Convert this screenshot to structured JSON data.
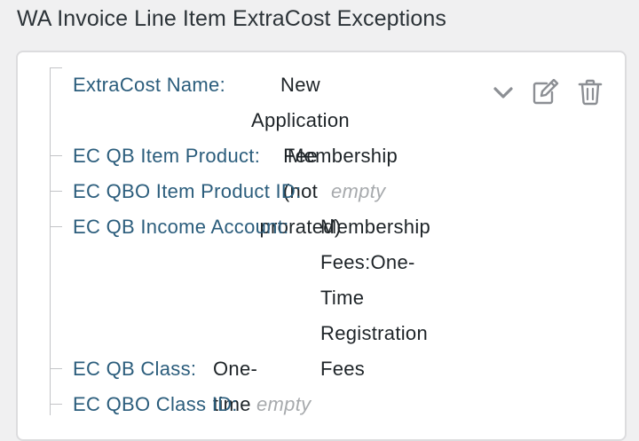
{
  "title": "WA Invoice Line Item ExtraCost Exceptions",
  "fields": [
    {
      "label": "ExtraCost Name:",
      "value": "New Application Fee\n(not prorated)"
    },
    {
      "label": "EC QB Item Product:",
      "value": "Membership"
    },
    {
      "label": "EC QBO Item Product ID:",
      "value": "empty"
    },
    {
      "label": "EC QB Income Account:",
      "value": "Membership\nFees:One-Time\nRegistration\nFees"
    },
    {
      "label": "EC QB Class:",
      "value": "One-time"
    },
    {
      "label": "EC QBO Class ID:",
      "value": "empty"
    }
  ],
  "actions": {
    "expand_icon": "chevron-down-icon",
    "edit_icon": "edit-icon",
    "delete_icon": "trash-icon"
  },
  "colors": {
    "label": "#2b5d7c",
    "value": "#1d2327",
    "empty": "#a7aaad",
    "icon": "#8c8f94"
  }
}
